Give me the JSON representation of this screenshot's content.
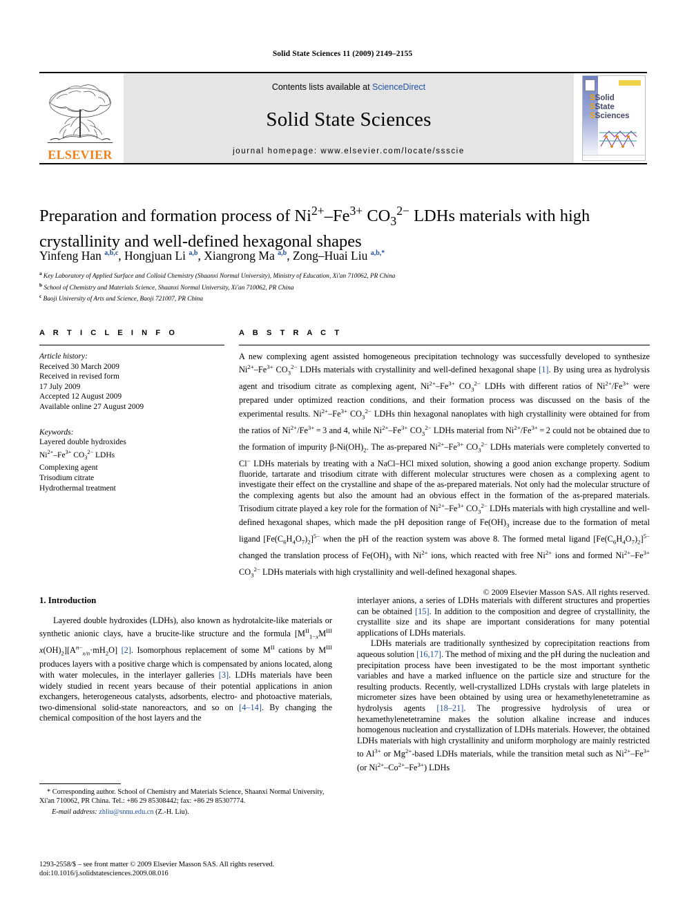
{
  "running_head": "Solid State Sciences 11 (2009) 2149–2155",
  "masthead": {
    "publisher_logo_word": "ELSEVIER",
    "contents_prefix": "Contents lists available at ",
    "contents_link": "ScienceDirect",
    "journal_title": "Solid State Sciences",
    "homepage_line": "journal homepage: www.elsevier.com/locate/ssscie",
    "cover": {
      "line1": "Solid",
      "line2": "State",
      "line3": "Sciences"
    }
  },
  "article": {
    "title_line1": "Preparation and formation process of Ni2+–Fe3+ CO32– LDHs materials with high",
    "title_line2": "crystallinity and well-defined hexagonal shapes",
    "title_html": "Preparation and formation process of Ni<sup>2+</sup>–Fe<sup>3+</sup> CO<sub>3</sub><sup>2–</sup> LDHs materials with high crystallinity and well-defined hexagonal shapes",
    "authors_html": "Yinfeng Han <sup>a,b,c</sup>, Hongjuan Li <sup>a,b</sup>, Xiangrong Ma <sup>a,b</sup>, Zong–Huai Liu <sup>a,b,*</sup>",
    "affiliations": [
      "Key Laboratory of Applied Surface and Colloid Chemistry (Shaanxi Normal University), Ministry of Education, Xi'an 710062, PR China",
      "School of Chemistry and Materials Science, Shaanxi Normal University, Xi'an 710062, PR China",
      "Baoji University of Arts and Science, Baoji 721007, PR China"
    ],
    "affiliation_marks": [
      "a",
      "b",
      "c"
    ]
  },
  "article_info": {
    "heading": "A R T I C L E  I N F O",
    "history_label": "Article history:",
    "history": [
      "Received 30 March 2009",
      "Received in revised form",
      "17 July 2009",
      "Accepted 12 August 2009",
      "Available online 27 August 2009"
    ],
    "keywords_label": "Keywords:",
    "keywords": [
      "Layered double hydroxides",
      "Ni2+–Fe3+ CO32– LDHs",
      "Complexing agent",
      "Trisodium citrate",
      "Hydrothermal treatment"
    ]
  },
  "abstract": {
    "heading": "A B S T R A C T",
    "copyright": "© 2009 Elsevier Masson SAS. All rights reserved."
  },
  "introduction": {
    "heading": "1.  Introduction"
  },
  "footnote": {
    "corresponding": "* Corresponding author. School of Chemistry and Materials Science, Shaanxi Normal University, Xi'an 710062, PR China. Tel.: +86 29 85308442; fax: +86 29 85307774.",
    "email_label": "E-mail address:",
    "email": "zhliu@snnu.edu.cn",
    "email_suffix": "(Z.-H. Liu).",
    "imprint_line1": "1293-2558/$ – see front matter © 2009 Elsevier Masson SAS. All rights reserved.",
    "imprint_line2": "doi:10.1016/j.solidstatesciences.2009.08.016"
  },
  "colors": {
    "elsevier_orange": "#F07F1A",
    "link_blue": "#1F4FA0",
    "masthead_grey": "#E5E5E5"
  }
}
